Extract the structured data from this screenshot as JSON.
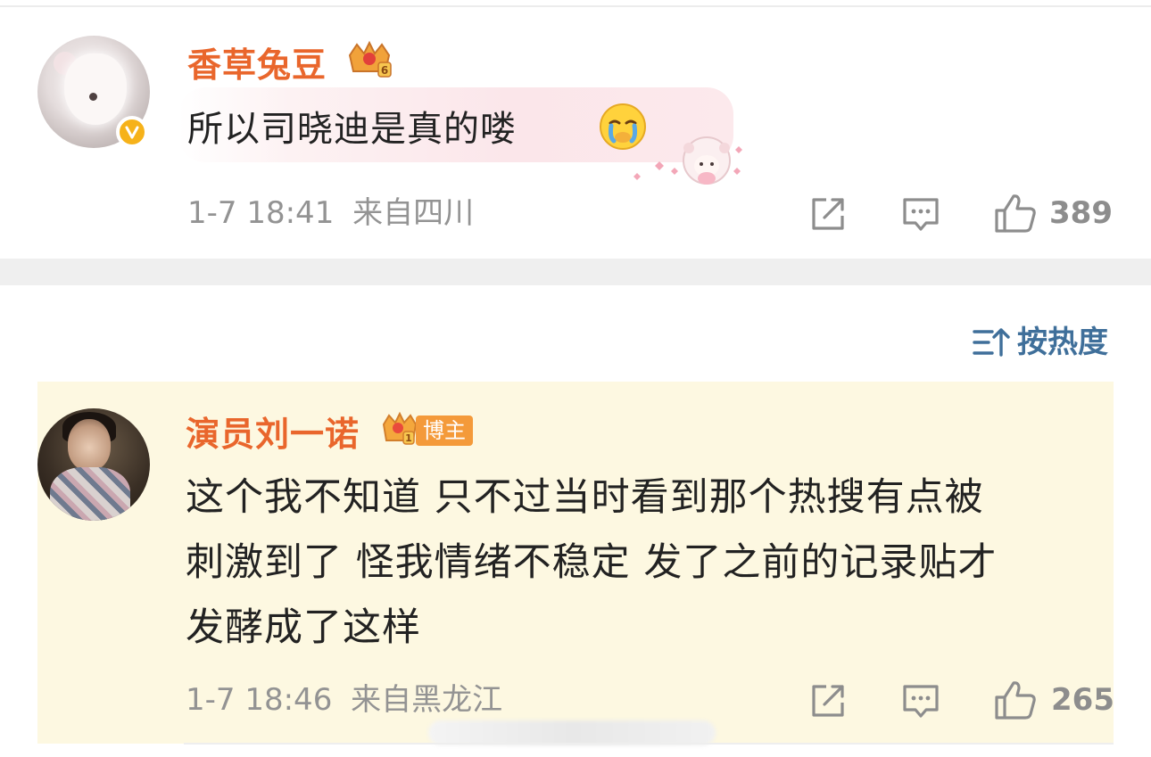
{
  "comment": {
    "username": "香草兔豆",
    "level_badge": "6",
    "text": "所以司晓迪是真的喽",
    "emoji": "crying-face-icon",
    "timestamp": "1-7 18:41",
    "location": "来自四川",
    "likes": "389"
  },
  "sort": {
    "label": "按热度"
  },
  "reply": {
    "username": "演员刘一诺",
    "level_badge": "1",
    "tag": "博主",
    "text_lines": [
      "这个我不知道 只不过当时看到那个热搜有点被",
      "刺激到了 怪我情绪不稳定 发了之前的记录贴才",
      "发酵成了这样"
    ],
    "timestamp": "1-7 18:46",
    "location": "来自黑龙江",
    "likes": "265"
  },
  "colors": {
    "username": "#e9662c",
    "sort_accent": "#3f6f9a",
    "reply_bg": "#fdf8e1",
    "verified_badge": "#f6b21a"
  }
}
